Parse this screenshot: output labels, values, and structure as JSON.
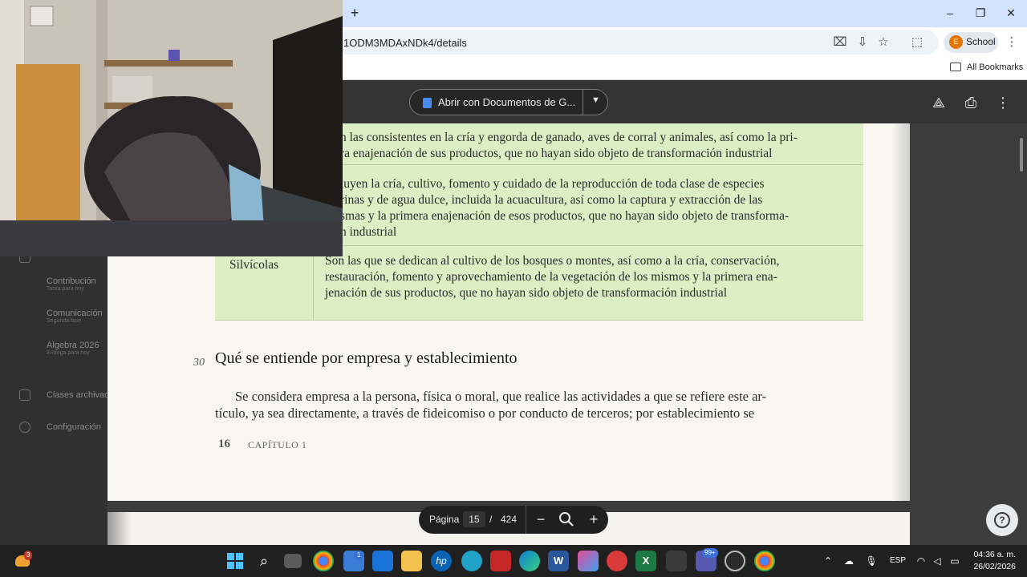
{
  "browser": {
    "new_tab": "+",
    "url": "1ODM3MDAxNDk4/details",
    "profile": {
      "initial": "E",
      "label": "School"
    },
    "all_bookmarks": "All Bookmarks",
    "window_controls": {
      "minimize": "–",
      "restore": "❐",
      "close": "✕"
    }
  },
  "background_app": {
    "items": [
      {
        "title": "Contribución",
        "subtitle": "Tarea para hoy"
      },
      {
        "title": "Comunicación",
        "subtitle": "Segunda fase"
      },
      {
        "title": "Álgebra 2026",
        "subtitle": "Entrega para hoy"
      },
      {
        "title": "Clases archivadas",
        "subtitle": ""
      },
      {
        "title": "Configuración",
        "subtitle": ""
      }
    ]
  },
  "viewer": {
    "open_with_label": "Abrir con Documentos de G...",
    "page_label": "Página",
    "current_page": "15",
    "separator": "/",
    "total_pages": "424"
  },
  "document": {
    "row1": [
      "n las consistentes en la cría y engorda de ganado, aves de corral y animales, así como la pri-",
      "ra enajenación de sus productos, que no hayan sido objeto de transformación industrial"
    ],
    "row2": [
      "luyen la cría, cultivo, fomento y cuidado de la reproducción de toda clase de especies",
      "rinas y de agua dulce, incluida la acuacultura, así como la captura y extracción de las",
      "smas y la primera enajenación de esos productos, que no hayan sido objeto de transforma-",
      "n industrial"
    ],
    "silvicolas_label": "Silvícolas",
    "silvicolas_text": [
      "Son las que se dedican al cultivo de los bosques o montes, así como a la cría, conservación,",
      "restauración, fomento y aprovechamiento de la vegetación de los mismos y la primera ena-",
      "jenación de sus productos, que no hayan sido objeto de transformación industrial"
    ],
    "section_number": "30",
    "section_title": "Qué se entiende por empresa y establecimiento",
    "paragraph": [
      "Se considera empresa a la persona, física o moral, que realice las actividades a que se refiere este ar-",
      "tículo, ya sea directamente, a través de fideicomiso o por conducto de terceros; por establecimiento se"
    ],
    "page_number": "16",
    "chapter": "CAPÍTULO 1"
  },
  "taskbar": {
    "weather_badge": "3",
    "store_badge": "1",
    "teams_badge": "99+",
    "language": "ESP",
    "time": "04:36 a. m.",
    "date": "26/02/2026"
  },
  "colors": {
    "tabstrip": "#d3e3fd",
    "table_green": "#dcefc4",
    "viewer_dark": "#333333",
    "page": "#f7f6f1",
    "taskbar": "#202020"
  }
}
